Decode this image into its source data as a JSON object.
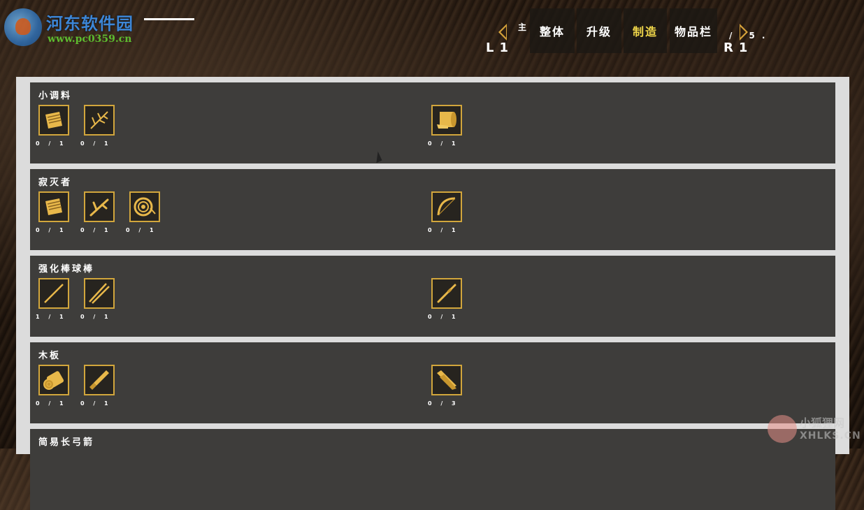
{
  "watermark": {
    "title": "河东软件园",
    "url": "www.pc0359.cn"
  },
  "nav": {
    "left_label": "主",
    "left_key": "L1",
    "right_key": "R1",
    "right_extra": "/ 5.",
    "tabs": [
      {
        "label": "整体",
        "active": false
      },
      {
        "label": "升级",
        "active": false
      },
      {
        "label": "制造",
        "active": true
      },
      {
        "label": "物品栏",
        "active": false
      }
    ]
  },
  "recipes": [
    {
      "name": "小调料",
      "ingredients": [
        {
          "icon": "cloth-icon",
          "qty": "0 / 1"
        },
        {
          "icon": "herb-icon",
          "qty": "0 / 1"
        }
      ],
      "result": {
        "icon": "bandage-roll-icon",
        "qty": "0 / 1"
      }
    },
    {
      "name": "寂灭者",
      "ingredients": [
        {
          "icon": "cloth-icon",
          "qty": "0 / 1"
        },
        {
          "icon": "branch-icon",
          "qty": "0 / 1"
        },
        {
          "icon": "rope-coil-icon",
          "qty": "0 / 1"
        }
      ],
      "result": {
        "icon": "bow-icon",
        "qty": "0 / 1"
      }
    },
    {
      "name": "强化棒球棒",
      "ingredients": [
        {
          "icon": "stick-icon",
          "qty": "1 / 1"
        },
        {
          "icon": "sticks-icon",
          "qty": "0 / 1"
        }
      ],
      "result": {
        "icon": "bat-icon",
        "qty": "0 / 1"
      }
    },
    {
      "name": "木板",
      "ingredients": [
        {
          "icon": "log-icon",
          "qty": "0 / 1"
        },
        {
          "icon": "knife-icon",
          "qty": "0 / 1"
        }
      ],
      "result": {
        "icon": "planks-icon",
        "qty": "0 / 3"
      }
    },
    {
      "name": "简易长弓箭",
      "ingredients": [],
      "result": null
    }
  ],
  "watermark2": {
    "title": "小狐狸网",
    "url": "XHLKS.CN"
  },
  "colors": {
    "accent": "#d2a63c",
    "active_tab": "#f2d84a",
    "section_bg": "#3e3d3b",
    "panel_bg": "#dcdcdc"
  }
}
